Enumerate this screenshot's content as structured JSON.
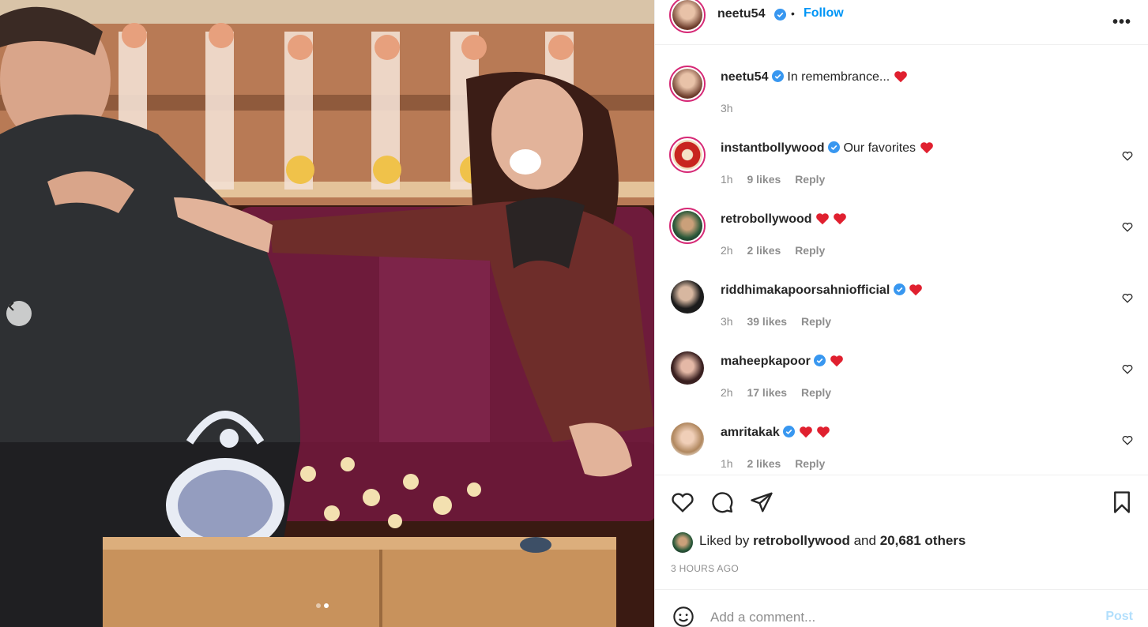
{
  "post": {
    "author": "neetu54",
    "follow_label": "Follow",
    "separator": "•",
    "more_label": "•••",
    "caption_text": "In remembrance...",
    "caption_time": "3h"
  },
  "comments": [
    {
      "user": "instantbollywood",
      "verified": true,
      "text": "Our favorites",
      "hearts": 1,
      "time": "1h",
      "likes": "9 likes",
      "reply": "Reply"
    },
    {
      "user": "retrobollywood",
      "verified": false,
      "text": "",
      "hearts": 2,
      "time": "2h",
      "likes": "2 likes",
      "reply": "Reply"
    },
    {
      "user": "riddhimakapoorsahniofficial",
      "verified": true,
      "text": "",
      "hearts": 1,
      "time": "3h",
      "likes": "39 likes",
      "reply": "Reply"
    },
    {
      "user": "maheepkapoor",
      "verified": true,
      "text": "",
      "hearts": 1,
      "time": "2h",
      "likes": "17 likes",
      "reply": "Reply"
    },
    {
      "user": "amritakak",
      "verified": true,
      "text": "",
      "hearts": 2,
      "time": "1h",
      "likes": "2 likes",
      "reply": "Reply"
    }
  ],
  "likes": {
    "prefix": "Liked by",
    "user": "retrobollywood",
    "middle": "and",
    "others": "20,681 others"
  },
  "posted_ago": "3 HOURS AGO",
  "add_comment": {
    "placeholder": "Add a comment...",
    "post_label": "Post"
  },
  "carousel": {
    "slide_count": 2,
    "active_index": 1
  },
  "icons": [
    "chevron-left-icon",
    "verified-icon",
    "heart-icon",
    "comment-icon",
    "share-icon",
    "bookmark-icon",
    "emoji-icon",
    "more-icon"
  ],
  "colors": {
    "accent": "#0095f6",
    "heart": "#ed4956",
    "verified": "#3897f0",
    "muted": "#8e8e8e",
    "post_disabled": "#b2dffc"
  }
}
